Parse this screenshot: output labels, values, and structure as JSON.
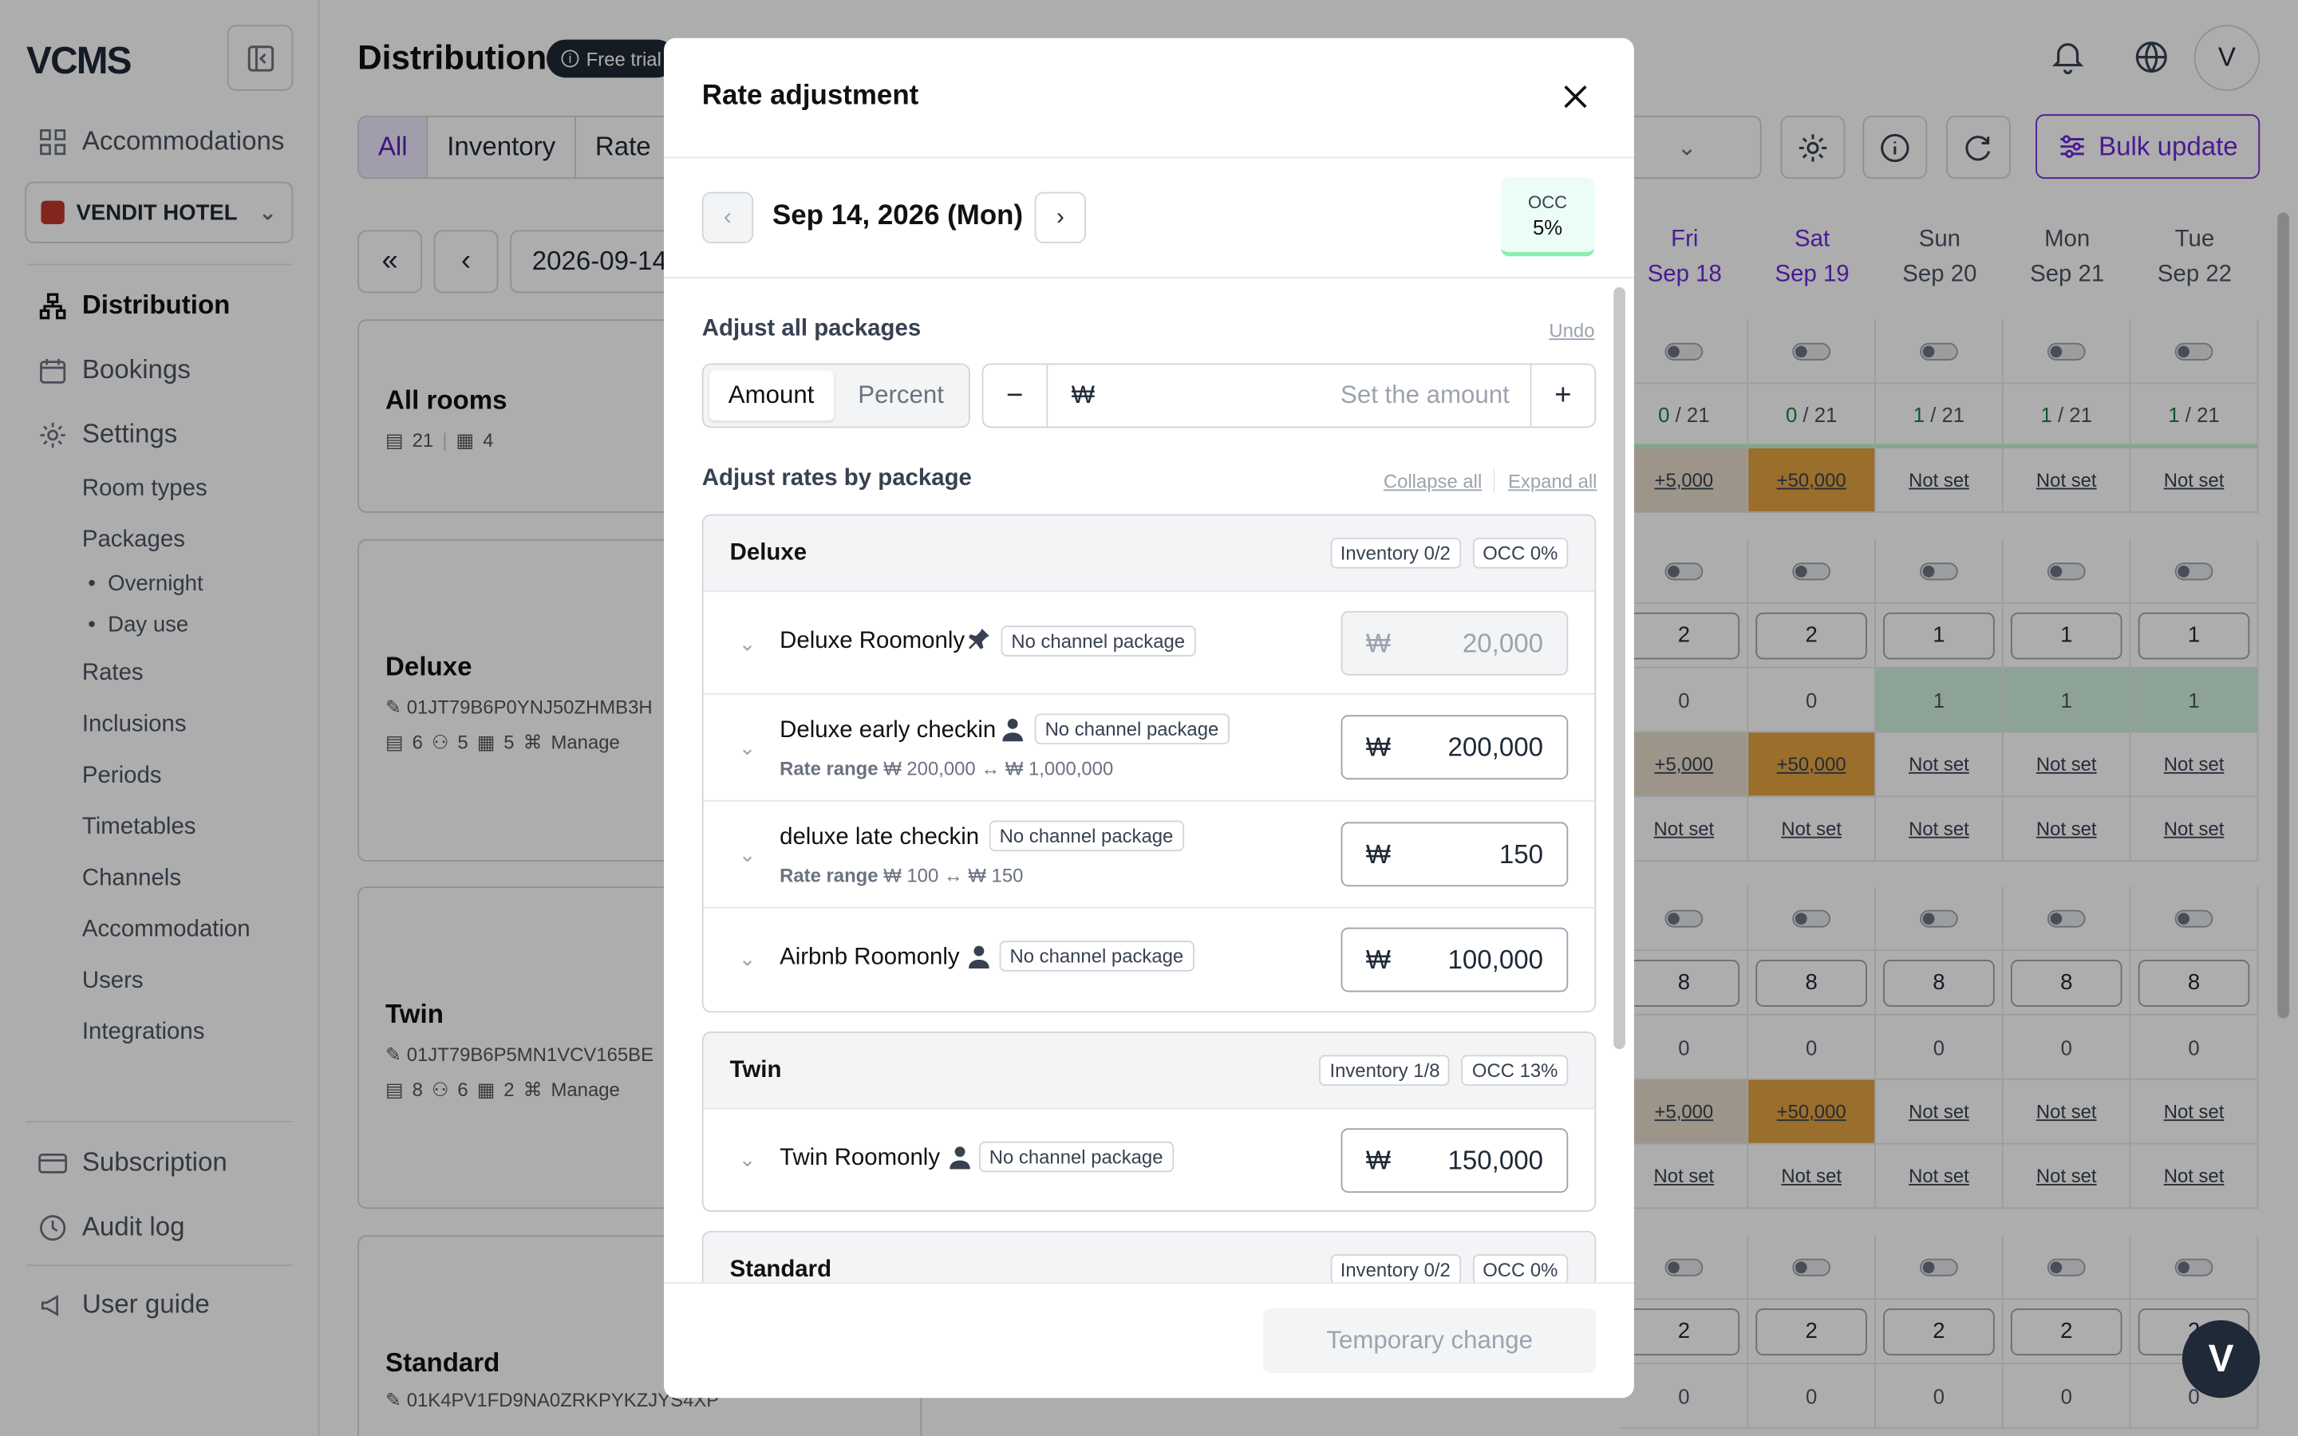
{
  "app": {
    "logo": "VCMS",
    "page_title": "Distribution",
    "badge": "Free trial",
    "avatar": "V"
  },
  "sidebar": {
    "accommodations": "Accommodations",
    "hotel": "VENDIT HOTEL",
    "distribution": "Distribution",
    "bookings": "Bookings",
    "settings": "Settings",
    "settings_items": [
      "Room types",
      "Packages",
      "Rates",
      "Inclusions",
      "Periods",
      "Timetables",
      "Channels",
      "Accommodation",
      "Users",
      "Integrations"
    ],
    "packages_items": [
      "Overnight",
      "Day use"
    ],
    "subscription": "Subscription",
    "audit_log": "Audit log",
    "user_guide": "User guide"
  },
  "toolbar": {
    "tabs": [
      "All",
      "Inventory",
      "Rate"
    ],
    "date": "2026-09-14",
    "bulk_update": "Bulk update"
  },
  "grid": {
    "days": [
      {
        "dow": "Fri",
        "date": "Sep 18",
        "weekend": true
      },
      {
        "dow": "Sat",
        "date": "Sep 19",
        "weekend": true
      },
      {
        "dow": "Sun",
        "date": "Sep 20",
        "weekend": false
      },
      {
        "dow": "Mon",
        "date": "Sep 21",
        "weekend": false
      },
      {
        "dow": "Tue",
        "date": "Sep 22",
        "weekend": false
      }
    ],
    "all_rooms": {
      "name": "All rooms",
      "inv": "21",
      "pkgs": "4",
      "avail": [
        "0",
        "0",
        "1",
        "1",
        "1"
      ],
      "total": "/ 21",
      "rates": [
        "+5,000",
        "+50,000",
        "Not set",
        "Not set",
        "Not set"
      ]
    },
    "deluxe": {
      "name": "Deluxe",
      "id": "01JT79B6P0YNJ50ZHMB3H",
      "meta": [
        "6",
        "5",
        "5",
        "Manage"
      ],
      "inv": [
        "2",
        "2",
        "1",
        "1",
        "1"
      ],
      "sold": [
        "0",
        "0",
        "1",
        "1",
        "1"
      ],
      "rates": [
        "+5,000",
        "+50,000",
        "Not set",
        "Not set",
        "Not set"
      ],
      "rates2": [
        "Not set",
        "Not set",
        "Not set",
        "Not set",
        "Not set"
      ]
    },
    "twin": {
      "name": "Twin",
      "id": "01JT79B6P5MN1VCV165BE",
      "meta": [
        "8",
        "6",
        "2",
        "Manage"
      ],
      "inv": [
        "8",
        "8",
        "8",
        "8",
        "8"
      ],
      "sold": [
        "0",
        "0",
        "0",
        "0",
        "0"
      ],
      "rates": [
        "+5,000",
        "+50,000",
        "Not set",
        "Not set",
        "Not set"
      ],
      "rates2": [
        "Not set",
        "Not set",
        "Not set",
        "Not set",
        "Not set"
      ]
    },
    "standard": {
      "name": "Standard",
      "id": "01K4PV1FD9NA0ZRKPYKZJYS4XP",
      "inv": [
        "2",
        "2",
        "2",
        "2",
        "2"
      ],
      "sold": [
        "0",
        "0",
        "0",
        "0",
        "0"
      ]
    }
  },
  "modal": {
    "title": "Rate adjustment",
    "date": "Sep 14, 2026 (Mon)",
    "occ_label": "OCC",
    "occ_value": "5%",
    "adjust_all": "Adjust all packages",
    "undo": "Undo",
    "amount_tab": "Amount",
    "percent_tab": "Percent",
    "currency": "₩",
    "amount_placeholder": "Set the amount",
    "adjust_by": "Adjust rates by package",
    "collapse_all": "Collapse all",
    "expand_all": "Expand all",
    "no_channel": "No channel package",
    "rate_range_label": "Rate range",
    "deluxe": {
      "name": "Deluxe",
      "inventory": "Inventory 0/2",
      "occ": "OCC 0%",
      "packages": [
        {
          "name": "Deluxe Roomonly",
          "value": "20,000"
        },
        {
          "name": "Deluxe early checkin",
          "value": "200,000",
          "range": "₩ 200,000 ↔ ₩ 1,000,000"
        },
        {
          "name": "deluxe late checkin",
          "value": "150",
          "range": "₩ 100 ↔ ₩ 150"
        },
        {
          "name": "Airbnb Roomonly",
          "value": "100,000"
        }
      ]
    },
    "twin": {
      "name": "Twin",
      "inventory": "Inventory 1/8",
      "occ": "OCC 13%",
      "packages": [
        {
          "name": "Twin Roomonly",
          "value": "150,000"
        }
      ]
    },
    "standard": {
      "name": "Standard",
      "inventory": "Inventory 0/2",
      "occ": "OCC 0%"
    },
    "temp_change": "Temporary change"
  }
}
